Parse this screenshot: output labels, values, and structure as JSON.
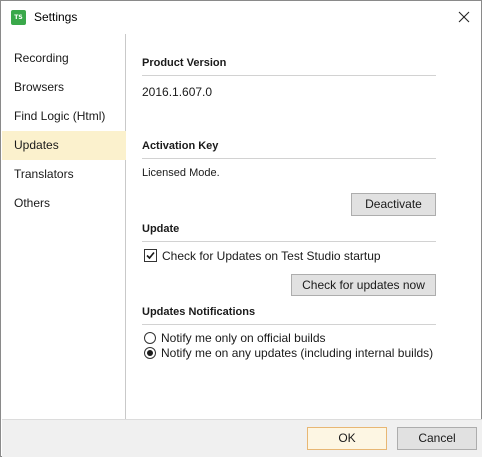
{
  "window": {
    "title": "Settings",
    "app_icon_text": "TS"
  },
  "sidebar": {
    "items": [
      {
        "label": "Recording"
      },
      {
        "label": "Browsers"
      },
      {
        "label": "Find Logic (Html)"
      },
      {
        "label": "Updates",
        "active": true
      },
      {
        "label": "Translators"
      },
      {
        "label": "Others"
      }
    ]
  },
  "updates": {
    "product_version_title": "Product Version",
    "product_version_value": "2016.1.607.0",
    "activation_key_title": "Activation Key",
    "activation_status": "Licensed Mode.",
    "deactivate_label": "Deactivate",
    "update_title": "Update",
    "check_on_startup_label": "Check for Updates on Test Studio startup",
    "check_on_startup_checked": true,
    "check_now_label": "Check for updates now",
    "notifications_title": "Updates Notifications",
    "notify_official_label": "Notify me only on official builds",
    "notify_any_label": "Notify me on any updates (including internal builds)",
    "notify_selected": "any"
  },
  "footer": {
    "ok_label": "OK",
    "cancel_label": "Cancel"
  },
  "colors": {
    "active_nav_bg": "#fbf1cd",
    "app_icon_bg": "#3aa84a",
    "ok_border": "#e8b774"
  }
}
